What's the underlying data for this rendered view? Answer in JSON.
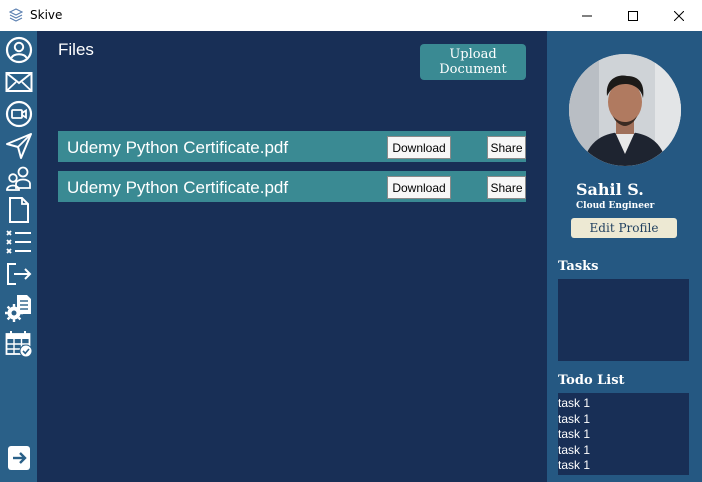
{
  "window": {
    "title": "Skive"
  },
  "sidebar": {
    "icons": [
      "profile-icon",
      "mail-icon",
      "video-call-icon",
      "send-icon",
      "users-icon",
      "document-icon",
      "task-list-icon",
      "logout-icon",
      "settings-document-icon",
      "calendar-check-icon"
    ],
    "expand_icon": "arrow-right-icon"
  },
  "main": {
    "title": "Files",
    "upload_label": "Upload\nDocument",
    "files": [
      {
        "name": "Udemy Python Certificate.pdf",
        "download_label": "Download",
        "share_label": "Share"
      },
      {
        "name": "Udemy Python Certificate.pdf",
        "download_label": "Download",
        "share_label": "Share"
      }
    ]
  },
  "profile": {
    "name": "Sahil S.",
    "role": "Cloud Engineer",
    "edit_label": "Edit Profile",
    "tasks_title": "Tasks",
    "todo_title": "Todo List",
    "todo_items": [
      "task 1",
      "task 1",
      "task 1",
      "task 1",
      "task 1"
    ]
  },
  "colors": {
    "sidebar": "#2a6088",
    "main_bg": "#182f56",
    "accent": "#3a8a93",
    "profile_bg": "#255882",
    "edit_button": "#ede9d3"
  }
}
